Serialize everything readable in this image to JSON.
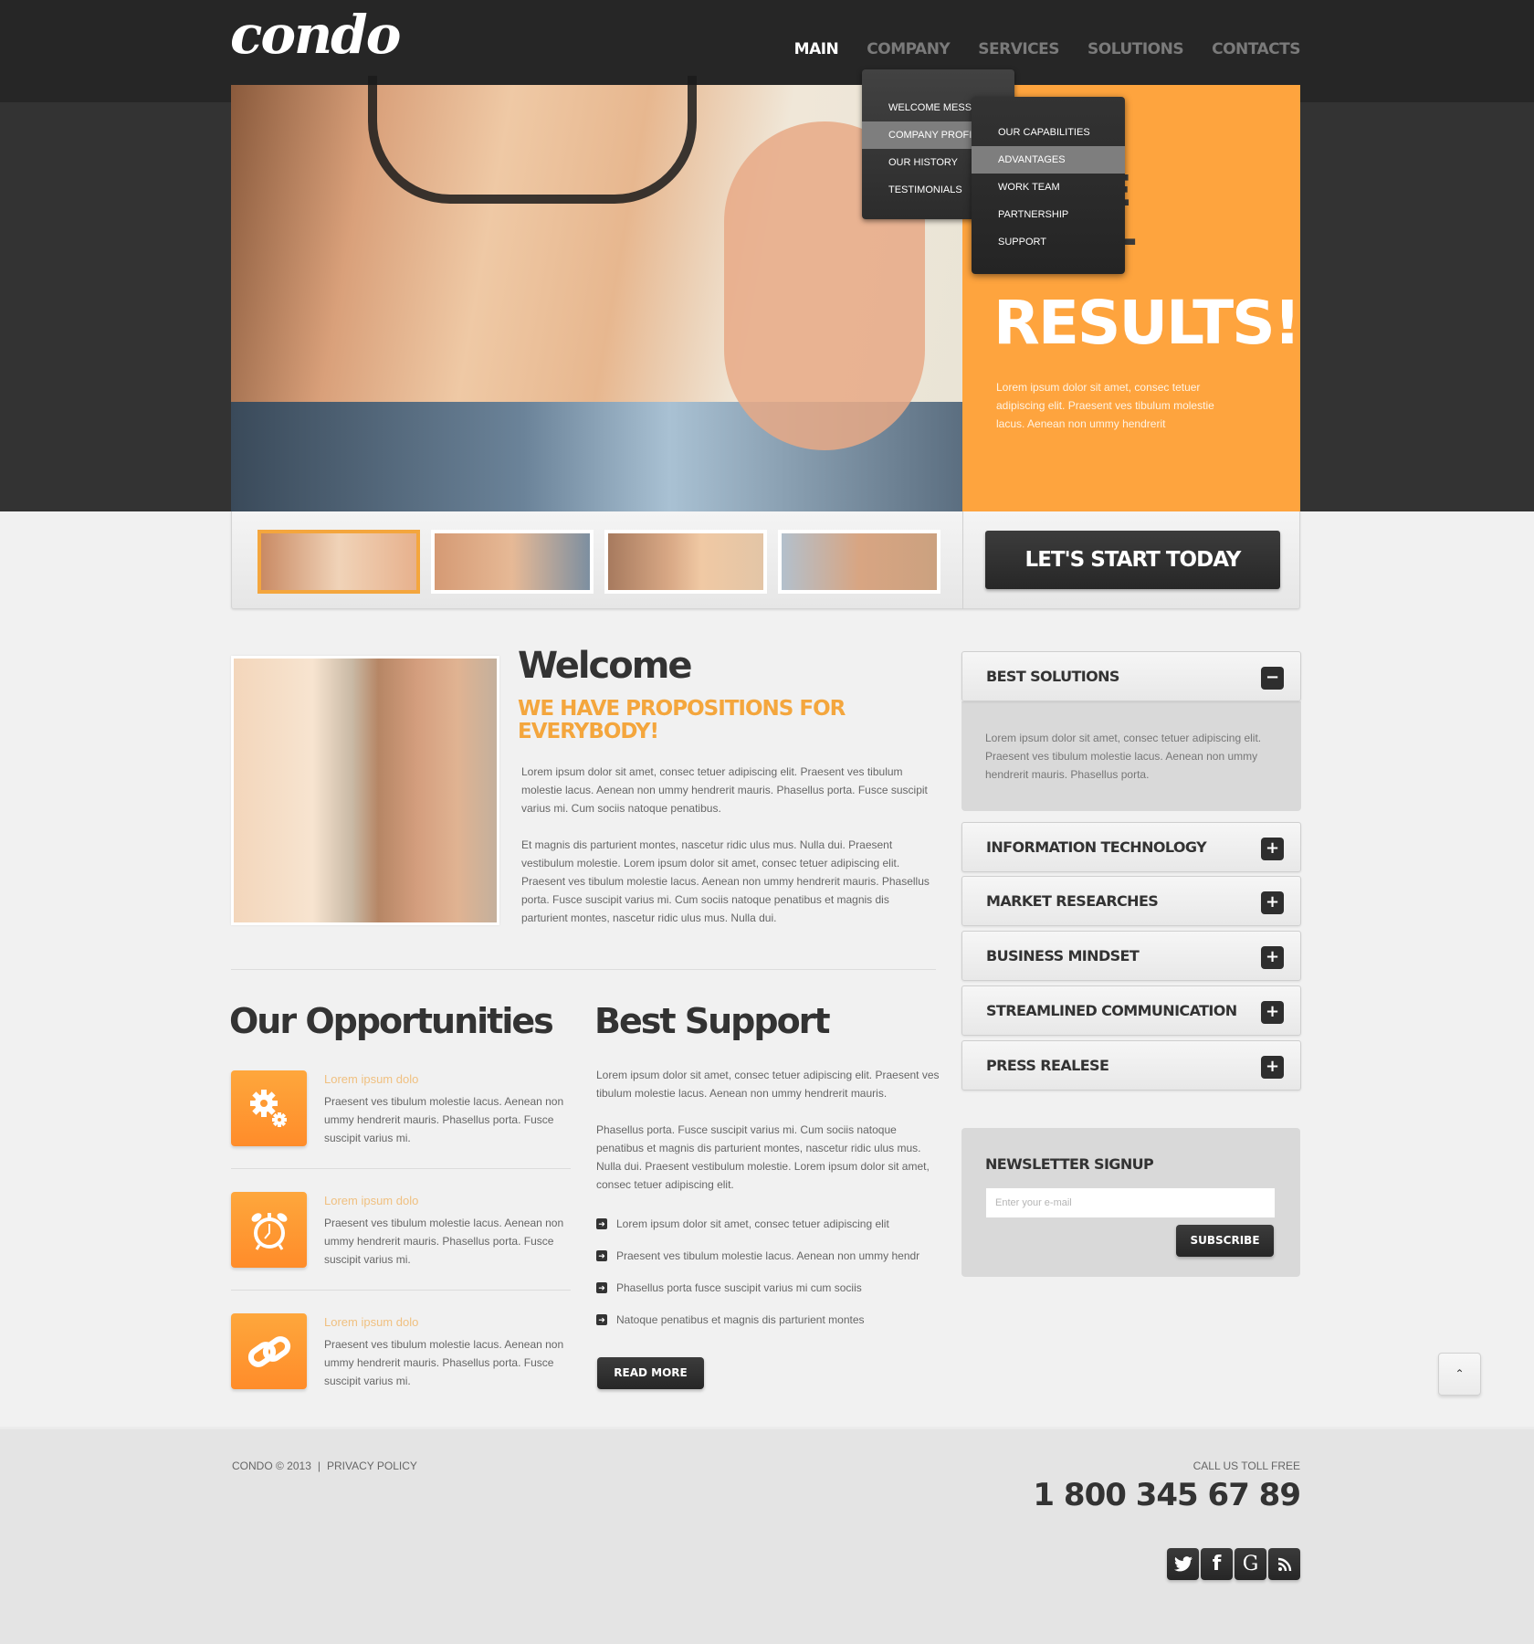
{
  "header": {
    "logo": "condo",
    "nav": [
      {
        "label": "MAIN",
        "active": true
      },
      {
        "label": "COMPANY",
        "active": false
      },
      {
        "label": "SERVICES",
        "active": false
      },
      {
        "label": "SOLUTIONS",
        "active": false
      },
      {
        "label": "CONTACTS",
        "active": false
      }
    ]
  },
  "dropdown": {
    "level1": [
      {
        "label": "WELCOME MESSAGE",
        "highlighted": false
      },
      {
        "label": "COMPANY PROFILE",
        "highlighted": true
      },
      {
        "label": "OUR HISTORY",
        "highlighted": false
      },
      {
        "label": "TESTIMONIALS",
        "highlighted": false
      }
    ],
    "level2": [
      {
        "label": "OUR CAPABILITIES",
        "highlighted": false
      },
      {
        "label": "ADVANTAGES",
        "highlighted": true
      },
      {
        "label": "WORK TEAM",
        "highlighted": false
      },
      {
        "label": "PARTNERSHIP",
        "highlighted": false
      },
      {
        "label": "SUPPORT",
        "highlighted": false
      }
    ]
  },
  "hero": {
    "partial_line1": "E",
    "partial_line2": "T",
    "title": "RESULTS!",
    "text": "Lorem ipsum dolor sit amet, consec tetuer adipiscing elit. Praesent ves tibulum molestie lacus. Aenean non ummy hendrerit",
    "accent_color": "#fea43e"
  },
  "slider": {
    "thumbnails": [
      {
        "name": "man-with-glasses",
        "active": true
      },
      {
        "name": "man-with-headset",
        "active": false
      },
      {
        "name": "man-and-woman",
        "active": false
      },
      {
        "name": "smiling-man",
        "active": false
      }
    ],
    "cta": "LET'S START TODAY"
  },
  "welcome": {
    "title": "Welcome",
    "subtitle": "WE HAVE PROPOSITIONS FOR EVERYBODY!",
    "p1": "Lorem ipsum dolor sit amet, consec tetuer adipiscing elit. Praesent ves tibulum molestie lacus. Aenean non ummy hendrerit mauris. Phasellus porta. Fusce suscipit varius mi. Cum sociis natoque penatibus.",
    "p2": "Et magnis dis parturient montes, nascetur ridic ulus mus. Nulla dui. Praesent vestibulum molestie. Lorem ipsum dolor sit amet, consec tetuer adipiscing elit. Praesent ves tibulum molestie lacus. Aenean non ummy hendrerit mauris. Phasellus porta. Fusce suscipit varius mi. Cum sociis natoque penatibus et magnis dis parturient montes, nascetur ridic ulus mus. Nulla dui."
  },
  "opportunities": {
    "title": "Our Opportunities",
    "items": [
      {
        "icon": "gears-icon",
        "heading": "Lorem ipsum dolo",
        "text": "Praesent ves tibulum molestie lacus. Aenean non ummy hendrerit mauris. Phasellus porta. Fusce suscipit varius mi."
      },
      {
        "icon": "alarm-clock-icon",
        "heading": "Lorem ipsum dolo",
        "text": "Praesent ves tibulum molestie lacus. Aenean non ummy hendrerit mauris. Phasellus porta. Fusce suscipit varius mi."
      },
      {
        "icon": "link-icon",
        "heading": "Lorem ipsum dolo",
        "text": "Praesent ves tibulum molestie lacus. Aenean non ummy hendrerit mauris. Phasellus porta. Fusce suscipit varius mi."
      }
    ]
  },
  "support": {
    "title": "Best Support",
    "p1": "Lorem ipsum dolor sit amet, consec tetuer adipiscing elit. Praesent ves tibulum molestie lacus. Aenean non ummy hendrerit mauris.",
    "p2": "Phasellus porta. Fusce suscipit varius mi. Cum sociis natoque penatibus et magnis dis parturient montes, nascetur ridic ulus mus. Nulla dui. Praesent vestibulum molestie. Lorem ipsum dolor sit amet, consec tetuer adipiscing elit.",
    "list": [
      "Lorem ipsum dolor sit amet, consec tetuer adipiscing elit",
      "Praesent ves tibulum molestie lacus. Aenean non ummy hendr",
      "Phasellus porta fusce suscipit varius mi cum sociis",
      "Natoque penatibus et magnis dis parturient montes"
    ],
    "read_more": "READ MORE"
  },
  "accordion": {
    "open": {
      "label": "BEST SOLUTIONS",
      "toggle": "−",
      "body": "Lorem ipsum dolor sit amet, consec tetuer adipiscing elit. Praesent ves tibulum molestie lacus. Aenean non ummy hendrerit mauris. Phasellus porta."
    },
    "closed": [
      {
        "label": "INFORMATION TECHNOLOGY",
        "toggle": "+"
      },
      {
        "label": "MARKET RESEARCHES",
        "toggle": "+"
      },
      {
        "label": "BUSINESS MINDSET",
        "toggle": "+"
      },
      {
        "label": "STREAMLINED COMMUNICATION",
        "toggle": "+"
      },
      {
        "label": "PRESS REALESE",
        "toggle": "+"
      }
    ]
  },
  "newsletter": {
    "title": "NEWSLETTER SIGNUP",
    "placeholder": "Enter your e-mail",
    "value": "",
    "button": "SUBSCRIBE"
  },
  "back_to_top": "⌃",
  "footer": {
    "copyright": "CONDO © 2013",
    "separator": "|",
    "privacy": "PRIVACY POLICY",
    "call_label": "CALL US TOLL FREE",
    "phone": "1 800 345 67 89",
    "social": [
      {
        "name": "twitter-icon",
        "glyph": "🐦"
      },
      {
        "name": "facebook-icon",
        "glyph": "f"
      },
      {
        "name": "google-icon",
        "glyph": "G"
      },
      {
        "name": "rss-icon",
        "glyph": "rss"
      }
    ]
  }
}
